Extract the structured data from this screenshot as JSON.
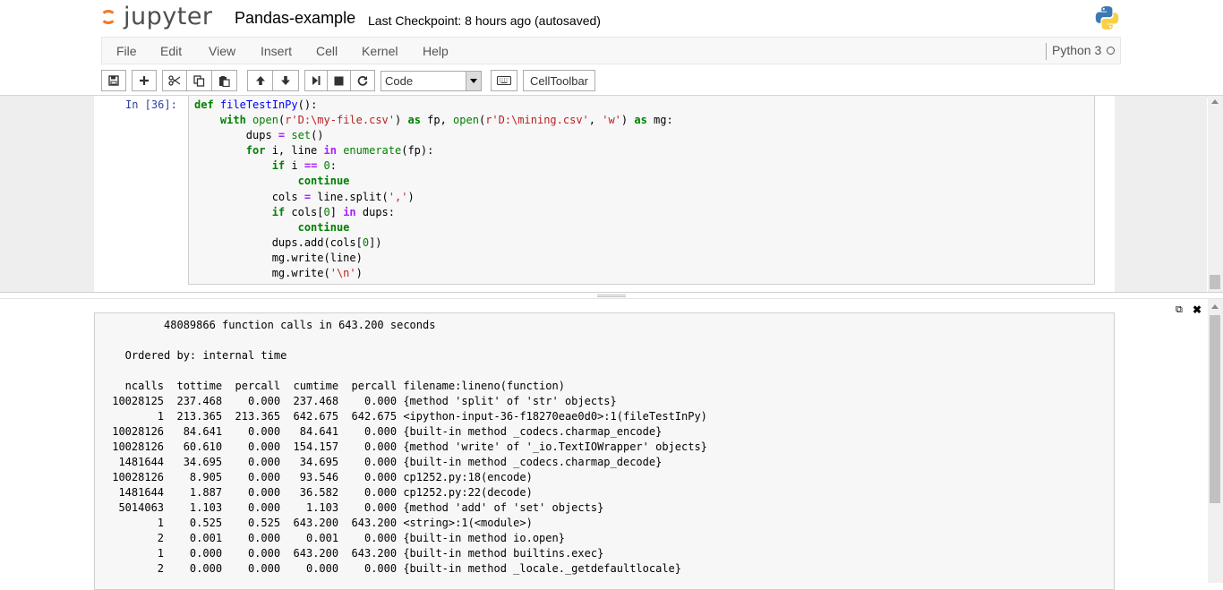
{
  "header": {
    "logo_text": "jupyter",
    "notebook_name": "Pandas-example",
    "checkpoint_status": "Last Checkpoint: 8 hours ago (autosaved)",
    "kernel_logo_icon": "python-logo-icon"
  },
  "menubar": {
    "items": [
      "File",
      "Edit",
      "View",
      "Insert",
      "Cell",
      "Kernel",
      "Help"
    ],
    "kernel_name": "Python 3",
    "kernel_status": "idle"
  },
  "toolbar": {
    "buttons": [
      {
        "name": "save-button",
        "icon": "floppy-disk-icon"
      },
      {
        "name": "insert-cell-below-button",
        "icon": "plus-icon"
      },
      {
        "name": "cut-cells-button",
        "icon": "scissors-icon"
      },
      {
        "name": "copy-cells-button",
        "icon": "copy-icon"
      },
      {
        "name": "paste-cells-button",
        "icon": "paste-icon"
      },
      {
        "name": "move-cell-up-button",
        "icon": "arrow-up-icon"
      },
      {
        "name": "move-cell-down-button",
        "icon": "arrow-down-icon"
      },
      {
        "name": "run-cell-button",
        "icon": "step-forward-icon"
      },
      {
        "name": "interrupt-kernel-button",
        "icon": "stop-icon"
      },
      {
        "name": "restart-kernel-button",
        "icon": "refresh-icon"
      },
      {
        "name": "command-palette-button",
        "icon": "keyboard-icon"
      }
    ],
    "cell_type": "Code",
    "celltoolbar_label": "CellToolbar"
  },
  "cell": {
    "prompt": "In [36]:",
    "code_lines": [
      "def fileTestInPy():",
      "    with open(r'D:\\my-file.csv') as fp, open(r'D:\\mining.csv', 'w') as mg:",
      "        dups = set()",
      "        for i, line in enumerate(fp):",
      "            if i == 0:",
      "                continue",
      "            cols = line.split(',')",
      "            if cols[0] in dups:",
      "                continue",
      "            dups.add(cols[0])",
      "            mg.write(line)",
      "            mg.write('\\n')"
    ]
  },
  "pager": {
    "expand_icon": "external-link-icon",
    "close_icon": "close-icon",
    "lines": [
      "         48089866 function calls in 643.200 seconds",
      "",
      "   Ordered by: internal time",
      "",
      "   ncalls  tottime  percall  cumtime  percall filename:lineno(function)",
      " 10028125  237.468    0.000  237.468    0.000 {method 'split' of 'str' objects}",
      "        1  213.365  213.365  642.675  642.675 <ipython-input-36-f18270eae0d0>:1(fileTestInPy)",
      " 10028126   84.641    0.000   84.641    0.000 {built-in method _codecs.charmap_encode}",
      " 10028126   60.610    0.000  154.157    0.000 {method 'write' of '_io.TextIOWrapper' objects}",
      "  1481644   34.695    0.000   34.695    0.000 {built-in method _codecs.charmap_decode}",
      " 10028126    8.905    0.000   93.546    0.000 cp1252.py:18(encode)",
      "  1481644    1.887    0.000   36.582    0.000 cp1252.py:22(decode)",
      "  5014063    1.103    0.000    1.103    0.000 {method 'add' of 'set' objects}",
      "        1    0.525    0.525  643.200  643.200 <string>:1(<module>)",
      "        2    0.001    0.000    0.001    0.000 {built-in method io.open}",
      "        1    0.000    0.000  643.200  643.200 {built-in method builtins.exec}",
      "        2    0.000    0.000    0.000    0.000 {built-in method _locale._getdefaultlocale}"
    ]
  },
  "colors": {
    "jupyter_orange": "#f37726",
    "prompt_blue": "#303f9f",
    "keyword_green": "#008000",
    "string_red": "#ba2121",
    "function_blue": "#0000ff"
  }
}
